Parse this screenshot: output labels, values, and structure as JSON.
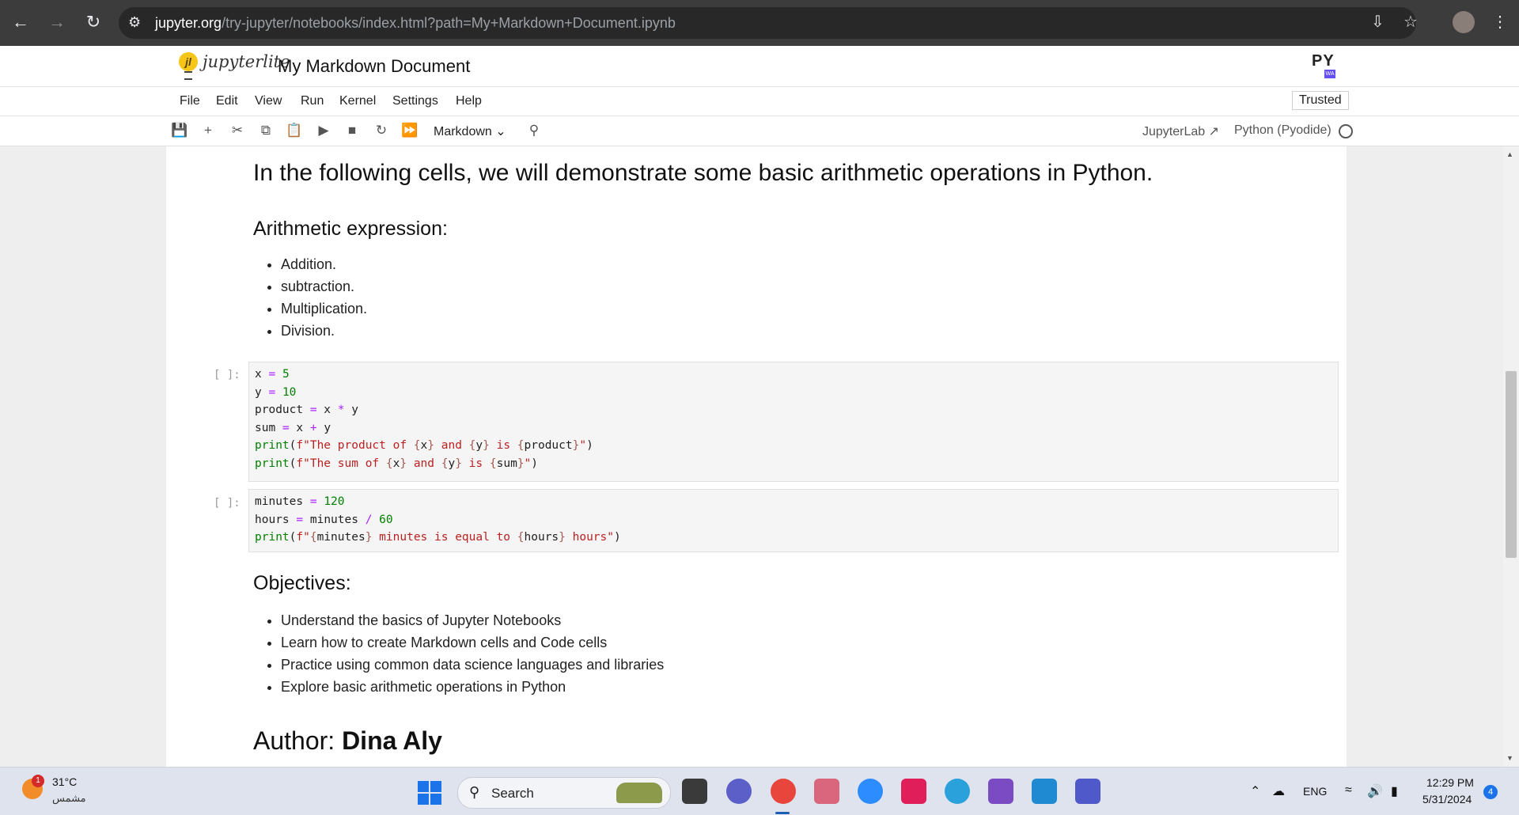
{
  "browser": {
    "url_host": "jupyter.org",
    "url_path": "/try-jupyter/notebooks/index.html?path=My+Markdown+Document.ipynb"
  },
  "header": {
    "logo_text": "jupyterlite",
    "document_title": "My Markdown Document",
    "py_logo": "PY",
    "py_logo_sub": "WA"
  },
  "menu": {
    "items": [
      "File",
      "Edit",
      "View",
      "Run",
      "Kernel",
      "Settings",
      "Help"
    ],
    "trusted": "Trusted"
  },
  "toolbar": {
    "cell_type": "Markdown",
    "jupyterlab_link": "JupyterLab",
    "kernel": "Python (Pyodide)"
  },
  "notebook": {
    "intro_heading": "In the following cells, we will demonstrate some basic arithmetic operations in Python.",
    "arith_heading": "Arithmetic expression:",
    "arith_items": [
      "Addition.",
      "subtraction.",
      "Multiplication.",
      "Division."
    ],
    "cell_prompt": "[ ]:",
    "objectives_heading": "Objectives:",
    "objectives_items": [
      "Understand the basics of Jupyter Notebooks",
      "Learn how to create Markdown cells and Code cells",
      "Practice using common data science languages and libraries",
      "Explore basic arithmetic operations in Python"
    ],
    "author_label": "Author:",
    "author_name": "Dina Aly"
  },
  "taskbar": {
    "weather_temp": "31°C",
    "weather_desc": "مشمس",
    "weather_badge": "1",
    "search_label": "Search",
    "language": "ENG",
    "time": "12:29 PM",
    "date": "5/31/2024",
    "notification_count": "4"
  }
}
